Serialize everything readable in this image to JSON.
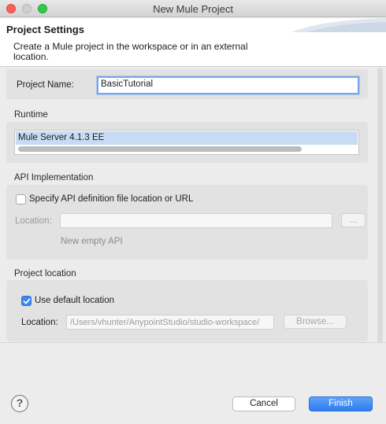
{
  "window": {
    "title": "New Mule Project"
  },
  "header": {
    "title": "Project Settings",
    "description": "Create a Mule project in the workspace or in an external location."
  },
  "project": {
    "name_label": "Project Name:",
    "name_value": "BasicTutorial"
  },
  "runtime": {
    "section_label": "Runtime",
    "items": [
      "Mule Server 4.1.3 EE"
    ],
    "selected": "Mule Server 4.1.3 EE"
  },
  "api": {
    "section_label": "API Implementation",
    "checkbox_label": "Specify API definition file location or URL",
    "checkbox_checked": false,
    "location_label": "Location:",
    "location_value": "",
    "browse_label": "...",
    "hint": "New empty API"
  },
  "project_location": {
    "section_label": "Project location",
    "checkbox_label": "Use default location",
    "checkbox_checked": true,
    "location_label": "Location:",
    "location_value": "/Users/vhunter/AnypointStudio/studio-workspace/",
    "browse_label": "Browse..."
  },
  "footer": {
    "help_icon": "?",
    "cancel_label": "Cancel",
    "finish_label": "Finish"
  },
  "colors": {
    "accent": "#2f7cf0",
    "selection": "#c7dcf4",
    "close": "#fc605c",
    "maximize": "#34c84a"
  }
}
